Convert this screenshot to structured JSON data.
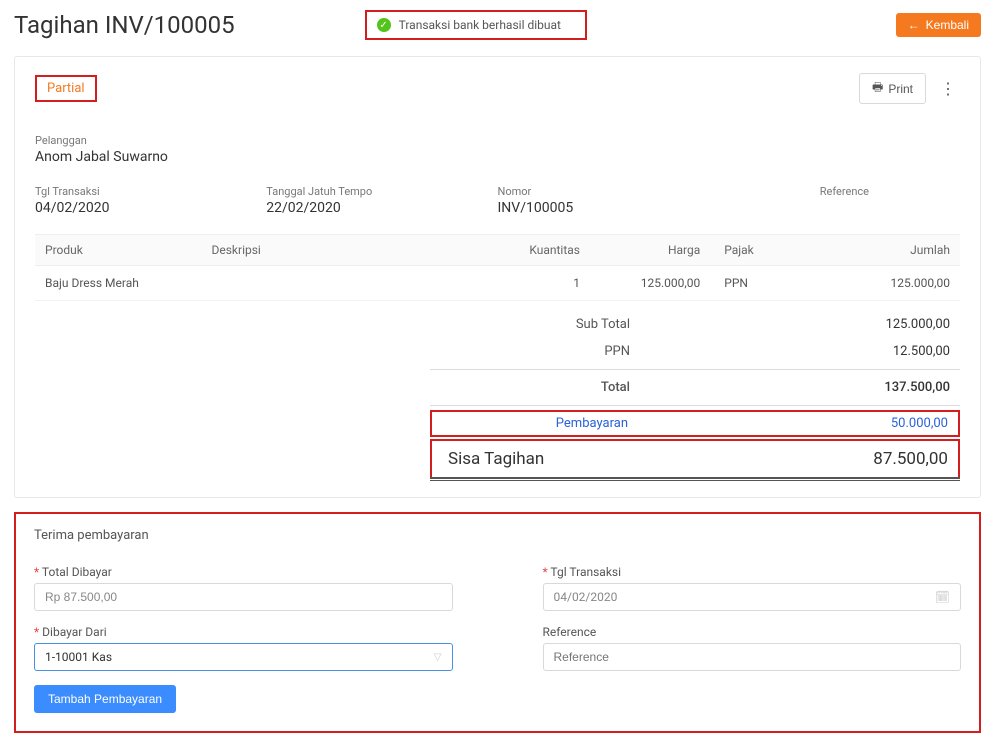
{
  "header": {
    "title": "Tagihan INV/100005",
    "toast": "Transaksi bank berhasil dibuat",
    "back": "Kembali"
  },
  "top": {
    "status": "Partial",
    "print": "Print"
  },
  "customer": {
    "label": "Pelanggan",
    "name": "Anom Jabal Suwarno"
  },
  "meta": {
    "tgl_label": "Tgl Transaksi",
    "tgl_value": "04/02/2020",
    "tempo_label": "Tanggal Jatuh Tempo",
    "tempo_value": "22/02/2020",
    "nomor_label": "Nomor",
    "nomor_value": "INV/100005",
    "ref_label": "Reference"
  },
  "cols": {
    "produk": "Produk",
    "deskripsi": "Deskripsi",
    "kuantitas": "Kuantitas",
    "harga": "Harga",
    "pajak": "Pajak",
    "jumlah": "Jumlah"
  },
  "lines": [
    {
      "produk": "Baju Dress Merah",
      "deskripsi": "",
      "qty": "1",
      "harga": "125.000,00",
      "pajak": "PPN",
      "jumlah": "125.000,00"
    }
  ],
  "summary": {
    "subtotal_l": "Sub Total",
    "subtotal_v": "125.000,00",
    "ppn_l": "PPN",
    "ppn_v": "12.500,00",
    "total_l": "Total",
    "total_v": "137.500,00",
    "pay_l": "Pembayaran",
    "pay_v": "50.000,00",
    "sisa_l": "Sisa Tagihan",
    "sisa_v": "87.500,00"
  },
  "pay": {
    "title": "Terima pembayaran",
    "total_l": "Total Dibayar",
    "total_v": "Rp 87.500,00",
    "tgl_l": "Tgl Transaksi",
    "tgl_v": "04/02/2020",
    "dari_l": "Dibayar Dari",
    "dari_v": "1-10001 Kas",
    "ref_l": "Reference",
    "ref_ph": "Reference",
    "btn": "Tambah Pembayaran"
  }
}
